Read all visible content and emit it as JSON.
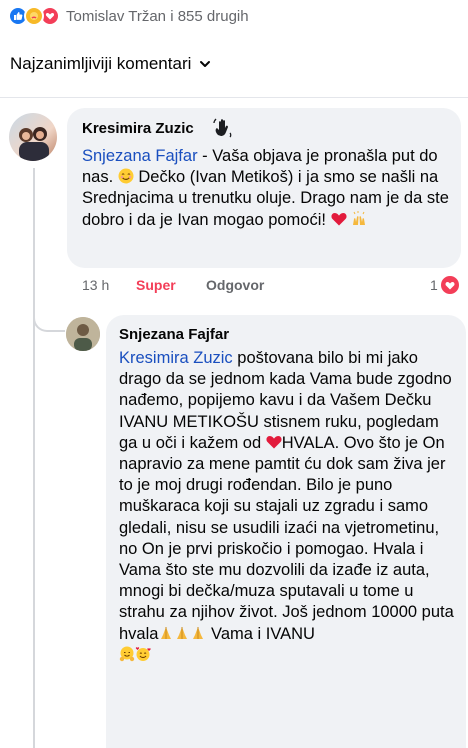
{
  "reactions": {
    "summary": "Tomislav Tržan i 855 drugih",
    "icons": [
      "like-icon",
      "care-icon",
      "love-icon"
    ]
  },
  "sort": {
    "label": "Najzanimljiviji komentari",
    "icon": "chevron-down-icon"
  },
  "comments": [
    {
      "author": "Kresimira Zuzic",
      "badge_icon": "waving-hand-icon",
      "mention": "Snjezana Fajfar",
      "text_a": " - Vaša objava je pronašla put do nas. ",
      "text_b": " Dečko (Ivan Metikoš) i ja smo se našli na Srednjacima u trenutku oluje. Drago nam je da ste dobro i da je Ivan mogao pomoći! ",
      "emojis": [
        "smiling-face-icon",
        "heart-icon",
        "raising-hands-icon"
      ],
      "time": "13 h",
      "reaction_action": "Super",
      "reply_label": "Odgovor",
      "reaction_count": "1"
    },
    {
      "author": "Snjezana Fajfar",
      "mention": "Kresimira Zuzic",
      "text_a": " poštovana bilo bi mi jako drago da se jednom kada Vama bude zgodno nađemo, popijemo kavu i da Vašem Dečku IVANU METIKOŠU stisnem ruku, pogledam ga u oči i kažem od ",
      "text_b": "HVALA. Ovo što je On napravio za mene pamtit ću dok sam živa jer to je moj drugi rođendan. Bilo je puno muškaraca koji su stajali uz zgradu i samo gledali, nisu se usudili izaći na vjetrometinu, no On je prvi priskočio i pomogao. Hvala i Vama što ste mu dozvolili da izađe iz auta, mnogi bi dečka/muza sputavali u tome u strahu za njihov život. Još jednom 10000 puta hvala",
      "text_c": " Vama i IVANU",
      "emojis": [
        "heart-icon",
        "folded-hands-icon",
        "hugging-face-icon",
        "smiling-face-with-hearts-icon"
      ]
    }
  ],
  "colors": {
    "mention": "#1a4fbf",
    "love": "#f33e58",
    "like": "#1877f2",
    "bubble": "#f0f2f5",
    "muted": "#65676b"
  }
}
